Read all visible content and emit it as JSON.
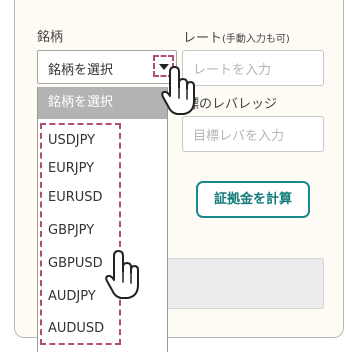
{
  "form": {
    "symbol_label": "銘柄",
    "symbol_select": {
      "value": "銘柄を選択"
    },
    "rate_label_main": "レート",
    "rate_label_note": "(手動入力も可)",
    "rate_input_placeholder": "レートを入力",
    "leverage_label": "標のレバレッジ",
    "leverage_input_placeholder": "目標レバを入力",
    "calc_button": "証拠金を計算"
  },
  "dropdown": {
    "header": "銘柄を選択",
    "items": [
      "USDJPY",
      "EURJPY",
      "EURUSD",
      "GBPJPY",
      "GBPUSD",
      "AUDJPY",
      "AUDUSD"
    ]
  },
  "colors": {
    "annotation_dashed": "#b44d72",
    "button_accent": "#1b8a8a",
    "dropdown_header_bg": "#b3b3b3"
  },
  "icons": [
    "pointer-hand-icon",
    "chevron-down-icon"
  ]
}
